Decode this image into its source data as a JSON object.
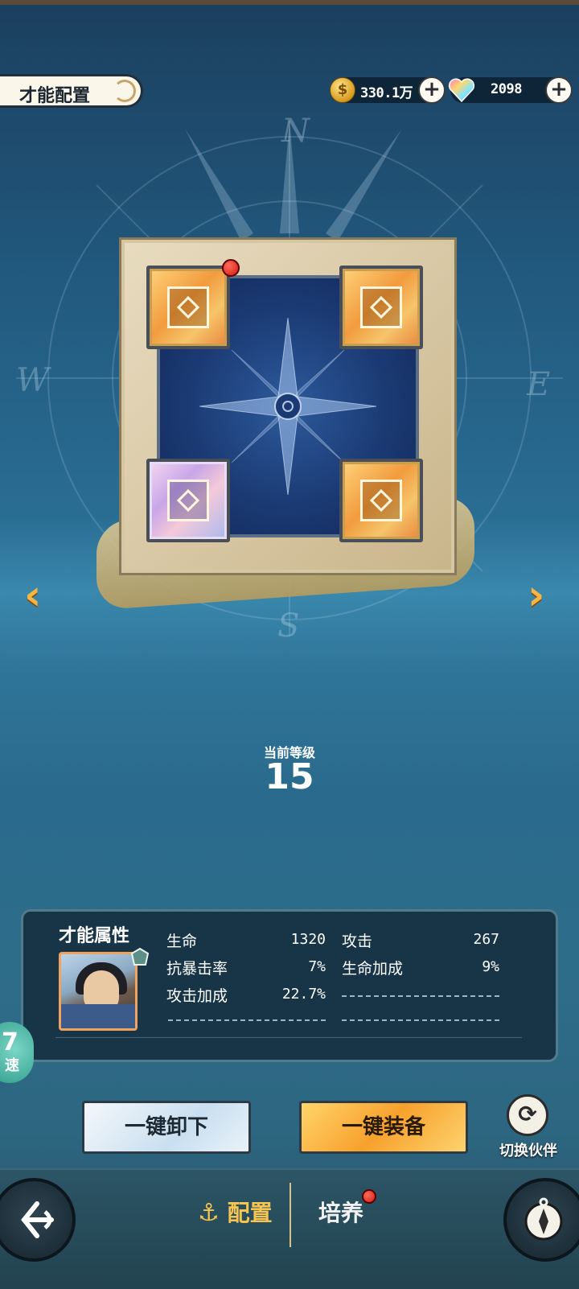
{
  "header": {
    "title": "才能配置",
    "gold": {
      "value": "330.1万",
      "icon": "gold-coin-icon"
    },
    "gems": {
      "value": "2098",
      "icon": "rainbow-heart-gem-icon"
    },
    "plus_symbol": "+"
  },
  "board": {
    "compass_letters": {
      "north": "N",
      "west": "W",
      "east": "E",
      "south": "S"
    },
    "slots": [
      {
        "position": "top-left",
        "style": "orange",
        "has_alert": true
      },
      {
        "position": "top-right",
        "style": "orange",
        "has_alert": false
      },
      {
        "position": "bottom-left",
        "style": "purple",
        "has_alert": false
      },
      {
        "position": "bottom-right",
        "style": "orange",
        "has_alert": false
      }
    ],
    "prev_arrow": "‹",
    "next_arrow": "›"
  },
  "level": {
    "label": "当前等级",
    "value": "15"
  },
  "attributes": {
    "title": "才能属性",
    "rows": [
      {
        "name_left": "生命",
        "value_left": "1320",
        "name_right": "攻击",
        "value_right": "267"
      },
      {
        "name_left": "抗暴击率",
        "value_left": "7%",
        "name_right": "生命加成",
        "value_right": "9%"
      },
      {
        "name_left": "攻击加成",
        "value_left": "22.7%"
      }
    ]
  },
  "actions": {
    "unload_all": "一键卸下",
    "equip_all": "一键装备",
    "switch_partner": "切换伙伴"
  },
  "side_float": {
    "number": "7",
    "label": "速"
  },
  "bottom_nav": {
    "tab_config": "配置",
    "tab_train": "培养",
    "tab_train_alert": true
  },
  "colors": {
    "accent_gold": "#f5c451",
    "alert_red": "#d11a10",
    "equip_orange": "#f7a12c"
  }
}
